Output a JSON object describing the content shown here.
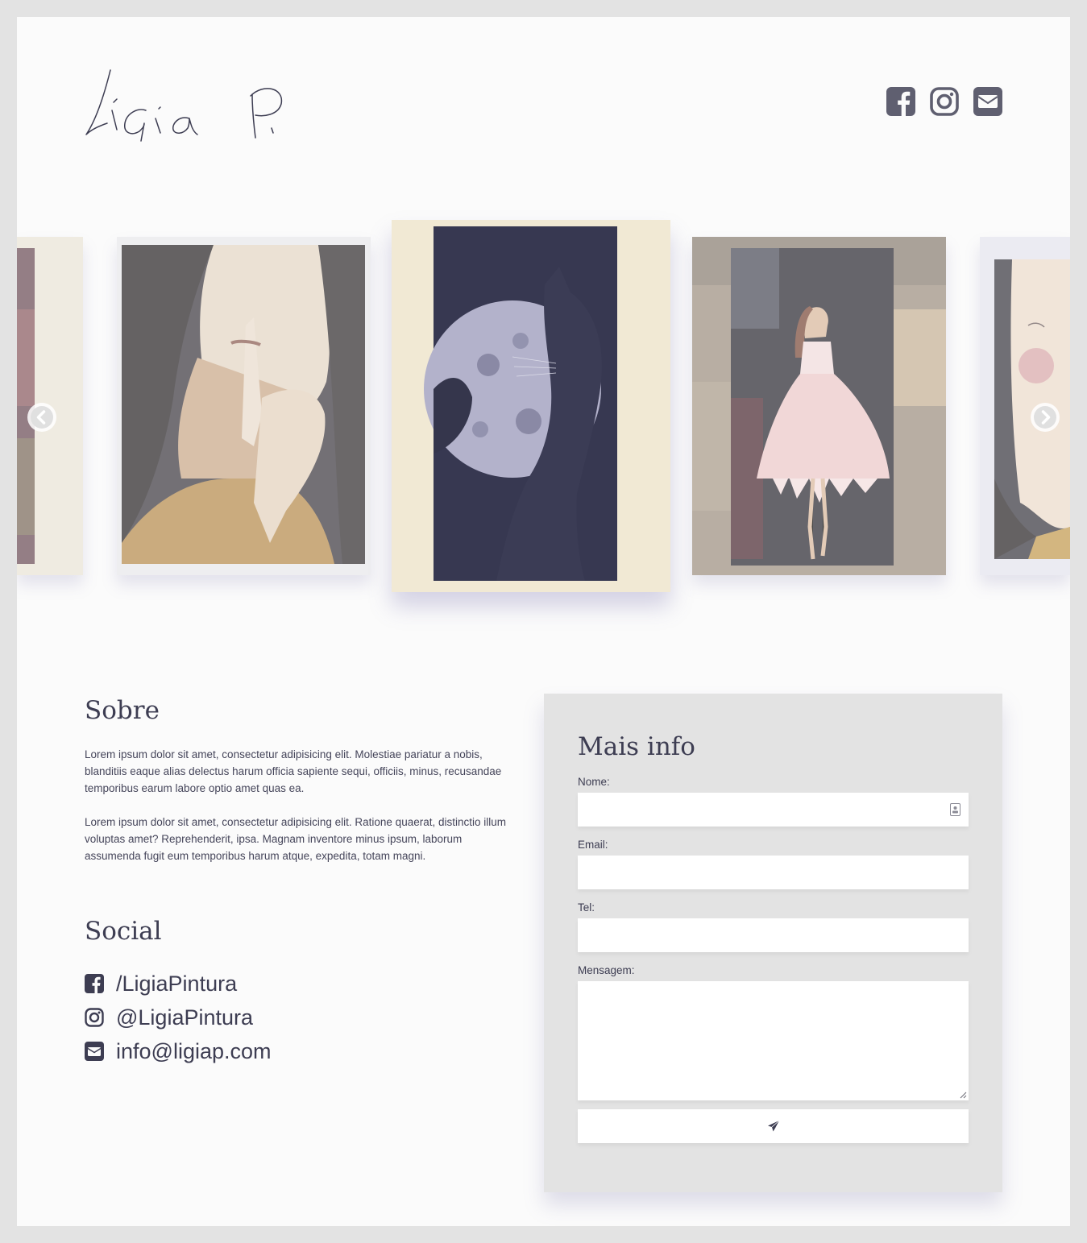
{
  "header": {
    "logo_text": "Lígia P.",
    "icons": [
      "facebook-icon",
      "instagram-icon",
      "envelope-icon"
    ]
  },
  "carousel": {
    "prev_icon": "chevron-left-icon",
    "next_icon": "chevron-right-icon",
    "slides": [
      "painting-partial-left",
      "painting-woman-shh",
      "painting-cat-moon",
      "painting-ballerina",
      "painting-partial-right"
    ]
  },
  "about": {
    "title": "Sobre",
    "paragraphs": [
      "Lorem ipsum dolor sit amet, consectetur adipisicing elit. Molestiae pariatur a nobis, blanditiis eaque alias delectus harum officia sapiente sequi, officiis, minus, recusandae temporibus earum labore optio amet quas ea.",
      "Lorem ipsum dolor sit amet, consectetur adipisicing elit. Ratione quaerat, distinctio illum voluptas amet? Reprehenderit, ipsa. Magnam inventore minus ipsum, laborum assumenda fugit eum temporibus harum atque, expedita, totam magni."
    ]
  },
  "social": {
    "title": "Social",
    "items": [
      {
        "icon": "facebook-square-icon",
        "label": "/LigiaPintura"
      },
      {
        "icon": "instagram-icon",
        "label": "@LigiaPintura"
      },
      {
        "icon": "envelope-square-icon",
        "label": "info@ligiap.com"
      }
    ]
  },
  "form": {
    "title": "Mais info",
    "name_label": "Nome:",
    "email_label": "Email:",
    "tel_label": "Tel:",
    "message_label": "Mensagem:",
    "name_value": "",
    "email_value": "",
    "tel_value": "",
    "message_value": "",
    "submit_icon": "paper-plane-icon"
  },
  "colors": {
    "page_bg": "#fbfbfb",
    "frame_bg": "#e3e3e3",
    "text": "#3d3d52",
    "icon": "#5f5f70",
    "shadow_tint": "#7873aa"
  }
}
